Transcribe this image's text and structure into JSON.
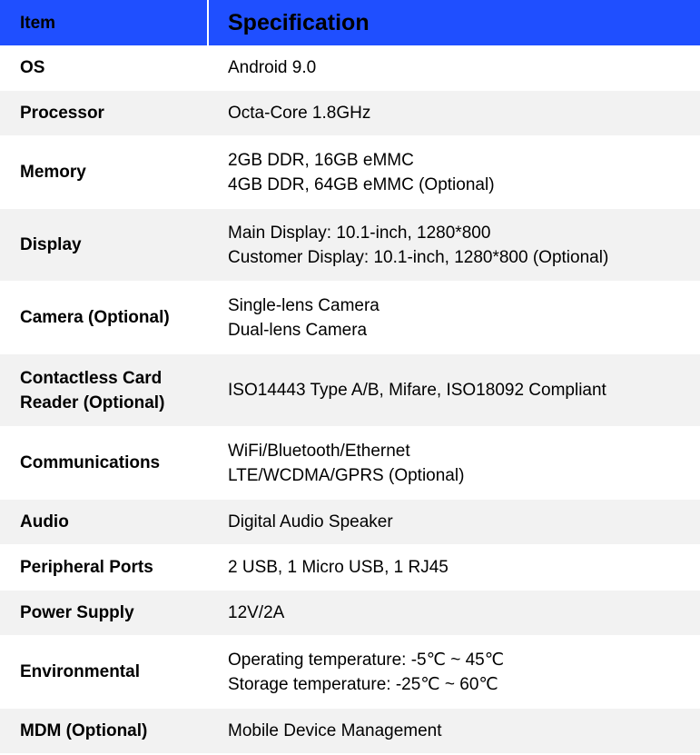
{
  "header": {
    "item_label": "Item",
    "spec_label": "Specification"
  },
  "rows": [
    {
      "item": "OS",
      "spec": [
        "Android 9.0"
      ]
    },
    {
      "item": "Processor",
      "spec": [
        "Octa-Core 1.8GHz"
      ]
    },
    {
      "item": "Memory",
      "spec": [
        "2GB DDR, 16GB eMMC",
        "4GB DDR, 64GB eMMC (Optional)"
      ]
    },
    {
      "item": "Display",
      "spec": [
        "Main Display: 10.1-inch, 1280*800",
        "Customer Display: 10.1-inch, 1280*800 (Optional)"
      ]
    },
    {
      "item": "Camera (Optional)",
      "spec": [
        "Single-lens Camera",
        "Dual-lens Camera"
      ]
    },
    {
      "item_lines": [
        "Contactless Card",
        "Reader (Optional)"
      ],
      "spec": [
        "ISO14443 Type A/B, Mifare, ISO18092 Compliant"
      ]
    },
    {
      "item": "Communications",
      "spec": [
        "WiFi/Bluetooth/Ethernet",
        "LTE/WCDMA/GPRS (Optional)"
      ]
    },
    {
      "item": "Audio",
      "spec": [
        "Digital Audio Speaker"
      ]
    },
    {
      "item": "Peripheral Ports",
      "spec": [
        "2 USB, 1 Micro USB, 1 RJ45"
      ]
    },
    {
      "item": "Power Supply",
      "spec": [
        "12V/2A"
      ]
    },
    {
      "item": "Environmental",
      "spec": [
        "Operating temperature: -5℃ ~ 45℃",
        "Storage temperature: -25℃ ~ 60℃"
      ]
    },
    {
      "item": "MDM (Optional)",
      "spec": [
        "Mobile Device Management"
      ]
    }
  ],
  "colors": {
    "header_bg": "#1f4fff",
    "row_alt_bg": "#f2f2f2"
  }
}
